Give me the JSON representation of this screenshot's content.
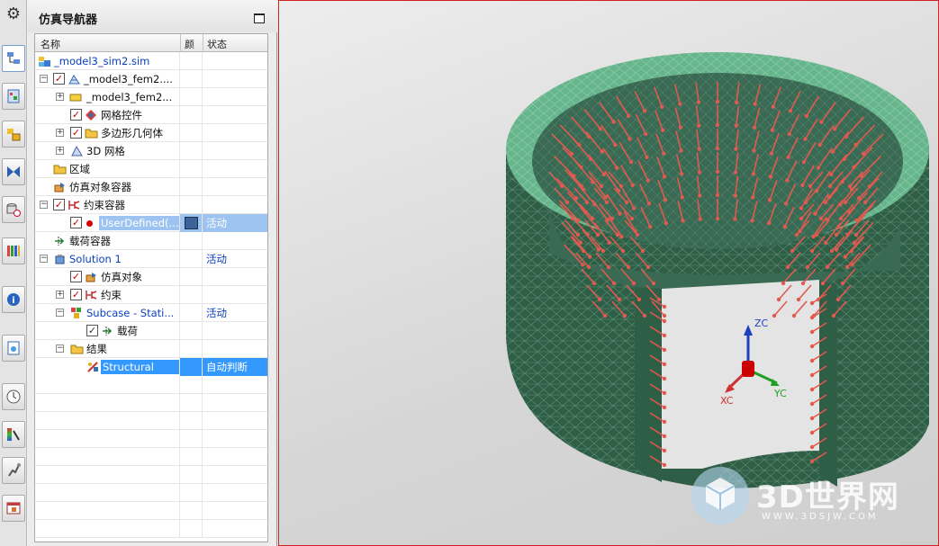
{
  "panel": {
    "title": "仿真导航器"
  },
  "columns": {
    "name": "名称",
    "color": "颜",
    "status": "状态"
  },
  "tree": [
    {
      "label": "_model3_sim2.sim",
      "status": ""
    },
    {
      "label": "_model3_fem2....",
      "status": ""
    },
    {
      "label": "_model3_fem2...",
      "status": ""
    },
    {
      "label": "网格控件",
      "status": ""
    },
    {
      "label": "多边形几何体",
      "status": ""
    },
    {
      "label": "3D 网格",
      "status": ""
    },
    {
      "label": "区域",
      "status": ""
    },
    {
      "label": "仿真对象容器",
      "status": ""
    },
    {
      "label": "约束容器",
      "status": ""
    },
    {
      "label": "UserDefined(...",
      "status": "活动",
      "swatch_color": "#3b6299"
    },
    {
      "label": "载荷容器",
      "status": ""
    },
    {
      "label": "Solution 1",
      "status": "活动"
    },
    {
      "label": "仿真对象",
      "status": ""
    },
    {
      "label": "约束",
      "status": ""
    },
    {
      "label": "Subcase - Stati...",
      "status": "活动"
    },
    {
      "label": "载荷",
      "status": ""
    },
    {
      "label": "结果",
      "status": ""
    },
    {
      "label": "Structural",
      "status": "自动判断"
    }
  ],
  "viewport": {
    "triad": {
      "zc": "ZC",
      "yc": "YC",
      "xc": "XC"
    },
    "mesh_color": "#2e5e45",
    "arrow_color": "#e05a50",
    "rim_color": "#62b587"
  },
  "watermark": {
    "brand": "3D世界网",
    "url": "WWW.3DSJW.COM"
  },
  "sidebar_icons": [
    "settings-icon",
    "navigator-icon",
    "tree-icon",
    "assembly-icon",
    "constraint-icon",
    "part-icon",
    "library-icon",
    "info-icon",
    "document-icon",
    "history-icon",
    "color-palette-icon",
    "robot-icon",
    "window-icon"
  ]
}
